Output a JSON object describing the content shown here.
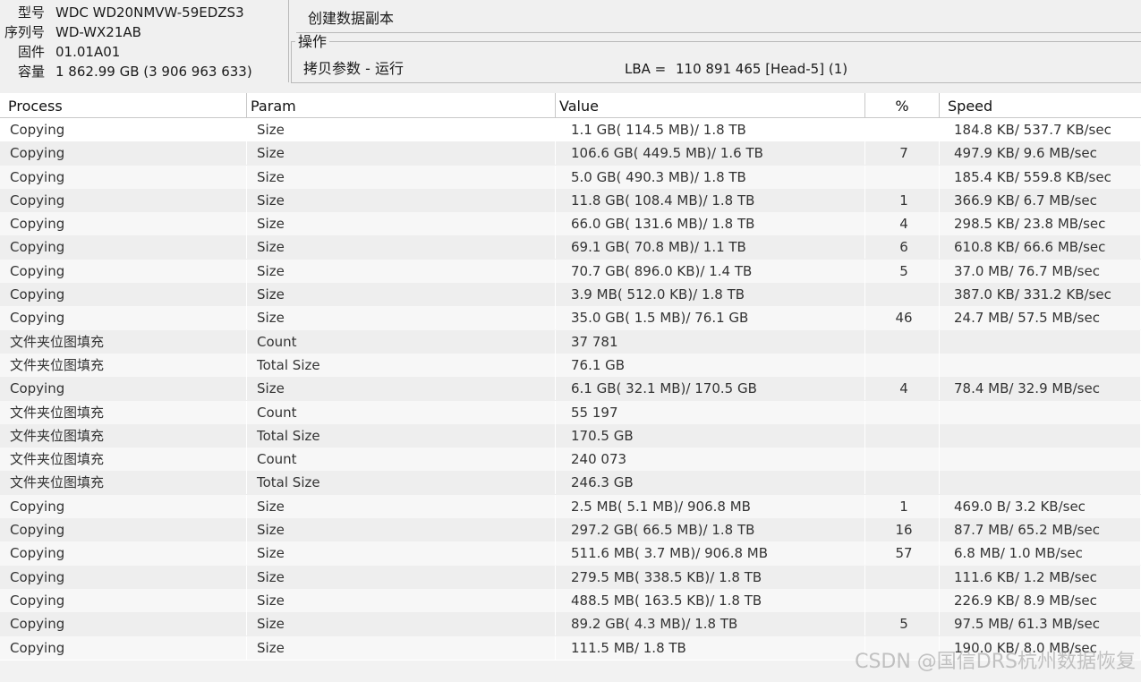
{
  "device": {
    "model_label": "型号",
    "model_value": "WDC WD20NMVW-59EDZS3",
    "serial_label": "序列号",
    "serial_value": "WD-WX21AB",
    "firmware_label": "固件",
    "firmware_value": "01.01A01",
    "capacity_label": "容量",
    "capacity_value": "1 862.99 GB (3 906 963 633)"
  },
  "task": {
    "title": "创建数据副本"
  },
  "operation": {
    "section_title": "操作",
    "status": "拷贝参数 - 运行",
    "lba_label": "LBA =",
    "lba_value": "110 891 465  [Head-5] (1)"
  },
  "table": {
    "columns": [
      "Process",
      "Param",
      "Value",
      "%",
      "Speed"
    ],
    "rows": [
      {
        "process": "Copying",
        "param": "Size",
        "value": "1.1 GB( 114.5 MB)/ 1.8 TB",
        "pct": "",
        "speed": "184.8 KB/ 537.7 KB/sec"
      },
      {
        "process": "Copying",
        "param": "Size",
        "value": "106.6 GB( 449.5 MB)/ 1.6 TB",
        "pct": "7",
        "speed": "497.9 KB/ 9.6 MB/sec"
      },
      {
        "process": "Copying",
        "param": "Size",
        "value": "5.0 GB( 490.3 MB)/ 1.8 TB",
        "pct": "",
        "speed": "185.4 KB/ 559.8 KB/sec"
      },
      {
        "process": "Copying",
        "param": "Size",
        "value": "11.8 GB( 108.4 MB)/ 1.8 TB",
        "pct": "1",
        "speed": "366.9 KB/ 6.7 MB/sec"
      },
      {
        "process": "Copying",
        "param": "Size",
        "value": "66.0 GB( 131.6 MB)/ 1.8 TB",
        "pct": "4",
        "speed": "298.5 KB/ 23.8 MB/sec"
      },
      {
        "process": "Copying",
        "param": "Size",
        "value": "69.1 GB( 70.8 MB)/ 1.1 TB",
        "pct": "6",
        "speed": "610.8 KB/ 66.6 MB/sec"
      },
      {
        "process": "Copying",
        "param": "Size",
        "value": "70.7 GB( 896.0 KB)/ 1.4 TB",
        "pct": "5",
        "speed": "37.0 MB/ 76.7 MB/sec"
      },
      {
        "process": "Copying",
        "param": "Size",
        "value": "3.9 MB( 512.0 KB)/ 1.8 TB",
        "pct": "",
        "speed": "387.0 KB/ 331.2 KB/sec"
      },
      {
        "process": "Copying",
        "param": "Size",
        "value": "35.0 GB( 1.5 MB)/ 76.1 GB",
        "pct": "46",
        "speed": "24.7 MB/ 57.5 MB/sec"
      },
      {
        "process": "文件夹位图填充",
        "param": "Count",
        "value": "37 781",
        "pct": "",
        "speed": ""
      },
      {
        "process": "文件夹位图填充",
        "param": "Total Size",
        "value": "76.1 GB",
        "pct": "",
        "speed": ""
      },
      {
        "process": "Copying",
        "param": "Size",
        "value": "6.1 GB( 32.1 MB)/ 170.5 GB",
        "pct": "4",
        "speed": "78.4 MB/ 32.9 MB/sec"
      },
      {
        "process": "文件夹位图填充",
        "param": "Count",
        "value": "55 197",
        "pct": "",
        "speed": ""
      },
      {
        "process": "文件夹位图填充",
        "param": "Total Size",
        "value": "170.5 GB",
        "pct": "",
        "speed": ""
      },
      {
        "process": "文件夹位图填充",
        "param": "Count",
        "value": "240 073",
        "pct": "",
        "speed": ""
      },
      {
        "process": "文件夹位图填充",
        "param": "Total Size",
        "value": "246.3 GB",
        "pct": "",
        "speed": ""
      },
      {
        "process": "Copying",
        "param": "Size",
        "value": "2.5 MB( 5.1 MB)/ 906.8 MB",
        "pct": "1",
        "speed": "469.0 B/ 3.2 KB/sec"
      },
      {
        "process": "Copying",
        "param": "Size",
        "value": "297.2 GB( 66.5 MB)/ 1.8 TB",
        "pct": "16",
        "speed": "87.7 MB/ 65.2 MB/sec"
      },
      {
        "process": "Copying",
        "param": "Size",
        "value": "511.6 MB( 3.7 MB)/ 906.8 MB",
        "pct": "57",
        "speed": "6.8 MB/ 1.0 MB/sec"
      },
      {
        "process": "Copying",
        "param": "Size",
        "value": "279.5 MB( 338.5 KB)/ 1.8 TB",
        "pct": "",
        "speed": "111.6 KB/ 1.2 MB/sec"
      },
      {
        "process": "Copying",
        "param": "Size",
        "value": "488.5 MB( 163.5 KB)/ 1.8 TB",
        "pct": "",
        "speed": "226.9 KB/ 8.9 MB/sec"
      },
      {
        "process": "Copying",
        "param": "Size",
        "value": "89.2 GB( 4.3 MB)/ 1.8 TB",
        "pct": "5",
        "speed": "97.5 MB/ 61.3 MB/sec"
      },
      {
        "process": "Copying",
        "param": "Size",
        "value": "111.5 MB/ 1.8 TB",
        "pct": "",
        "speed": "190.0 KB/ 8.0 MB/sec"
      }
    ]
  },
  "watermark": "CSDN @国信DRS杭州数据恢复"
}
